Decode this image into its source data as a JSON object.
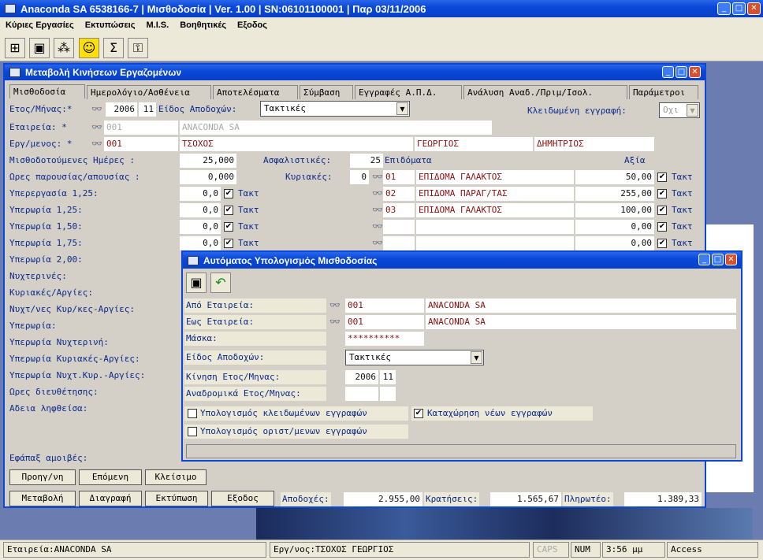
{
  "app": {
    "title": "Anaconda SA 6538166-7 | Μισθοδοσία | Ver. 1.00 | SN:06101100001 | Παρ 03/11/2006"
  },
  "menu": [
    "Κύριες Εργασίες",
    "Εκτυπώσεις",
    "M.I.S.",
    "Βοηθητικές",
    "Εξοδος"
  ],
  "toolbar_icons": [
    "tree-icon",
    "card-icon",
    "network-icon",
    "smiley-icon",
    "sigma-icon",
    "key-icon"
  ],
  "toolbar_sigma": "Σ",
  "main_window": {
    "title": "Μεταβολή Κινήσεων Εργαζομένων",
    "tabs": [
      "Μισθοδοσία",
      "Ημερολόγιο/Ασθένεια",
      "Αποτελέσματα",
      "Σύμβαση",
      "Εγγραφές Α.Π.Δ.",
      "Ανάλυση Αναδ./Πριμ/Ισολ.",
      "Παράμετροι"
    ],
    "etos_label": "Ετος/Μήνας:*",
    "etos": "2006",
    "minas": "11",
    "eidos_label": "Είδος Αποδοχών:",
    "eidos": "Τακτικές",
    "kleid_label": "Κλειδωμένη εγγραφή:",
    "kleid": "Οχι",
    "etaireia_label": "Εταιρεία:   *",
    "etaireia_code": "001",
    "etaireia_name": "ANACONDA SA",
    "ergaz_label": "Εργ/μενος: *",
    "ergaz_code": "001",
    "ergaz_surname": "ΤΣΟΧΟΣ",
    "ergaz_name": "ΓΕΩΡΓΙΟΣ",
    "ergaz_father": "ΔΗΜΗΤΡΙΟΣ",
    "misth_label": "Μισθοδοτούμενες Ημέρες :",
    "misth": "25,000",
    "asfal_label": "Ασφαλιστικές:",
    "asfal": "25",
    "epidomata_label": "Επιδόματα",
    "axia_label": "Αξία",
    "ores_label": "Ωρες παρουσίας/απουσίας :",
    "ores": "0,000",
    "kyriakes_label": "Κυριακές:",
    "kyriakes": "0",
    "rows": [
      {
        "label": "Υπερεργασία 1,25:",
        "val": "0,0",
        "takt": "Τακτ"
      },
      {
        "label": "Υπερωρία 1,25:",
        "val": "0,0",
        "takt": "Τακτ"
      },
      {
        "label": "Υπερωρία 1,50:",
        "val": "0,0",
        "takt": "Τακτ"
      },
      {
        "label": "Υπερωρία 1,75:",
        "val": "0,0",
        "takt": "Τακτ"
      },
      {
        "label": "Υπερωρία 2,00:"
      },
      {
        "label": "Νυχτερινές:"
      },
      {
        "label": "Κυριακές/Αργίες:"
      },
      {
        "label": "Νυχτ/νες Κυρ/κες-Αργίες:"
      },
      {
        "label": "Υπερωρία:"
      },
      {
        "label": "Υπερωρία Νυχτερινή:"
      },
      {
        "label": "Υπερωρία Κυριακές-Αργίες:"
      },
      {
        "label": "Υπερωρία Νυχτ.Κυρ.-Αργίες:"
      },
      {
        "label": "Ωρες διευθέτησης:"
      },
      {
        "label": "Αδεια ληφθείσα:"
      }
    ],
    "epidomata": [
      {
        "code": "01",
        "name": "ΕΠΙΔΟΜΑ ΓΑΛΑΚΤΟΣ",
        "value": "50,00",
        "takt": "Τακτ"
      },
      {
        "code": "02",
        "name": "ΕΠΙΔΟΜΑ ΠΑΡΑΓ/ΤΑΣ",
        "value": "255,00",
        "takt": "Τακτ"
      },
      {
        "code": "03",
        "name": "ΕΠΙΔΟΜΑ ΓΑΛΑΚΤΟΣ",
        "value": "100,00",
        "takt": "Τακτ"
      },
      {
        "code": "",
        "name": "",
        "value": "0,00",
        "takt": "Τακτ"
      },
      {
        "code": "",
        "name": "",
        "value": "0,00",
        "takt": "Τακτ"
      }
    ],
    "efapax_label": "Εφάπαξ αμοιβές:",
    "nav_buttons": [
      "Προηγ/νη",
      "Επόμενη",
      "Κλείσιμο"
    ],
    "action_buttons": [
      "Μεταβολή",
      "Διαγραφή",
      "Εκτύπωση",
      "Εξοδος"
    ],
    "apodoxes_label": "Αποδοχές:",
    "apodoxes": "2.955,00",
    "kratiseis_label": "Κρατήσεις:",
    "kratiseis": "1.565,67",
    "plirotea_label": "Πληρωτέο:",
    "plirotea": "1.389,33"
  },
  "dialog": {
    "title": "Αυτόματος Υπολογισμός Μισθοδοσίας",
    "apo_label": "Από Εταιρεία:",
    "apo_code": "001",
    "apo_name": "ANACONDA SA",
    "eos_label": "Εως Εταιρεία:",
    "eos_code": "001",
    "eos_name": "ANACONDA SA",
    "maska_label": "Μάσκα:",
    "maska": "**********",
    "eidos_label": "Είδος Αποδοχών:",
    "eidos": "Τακτικές",
    "kinisi_label": "Κίνηση Ετος/Μηνας:",
    "kinisi_etos": "2006",
    "kinisi_minas": "11",
    "anadr_label": "Αναδρομικά Ετος/Μηνας:",
    "chk1": "Υπολογισμός κλειδωμένων εγγραφών",
    "chk2": "Καταχώρηση νέων εγγραφών",
    "chk3": "Υπολογισμός οριστ/μενων εγγραφών"
  },
  "status": {
    "etaireia": "Εταιρεία:ANACONDA SA",
    "ergaz": "Εργ/νος:ΤΣΟΧΟΣ ΓΕΩΡΓΙΟΣ",
    "caps": "CAPS",
    "num": "NUM",
    "time": "3:56 μμ",
    "access": "Access"
  }
}
